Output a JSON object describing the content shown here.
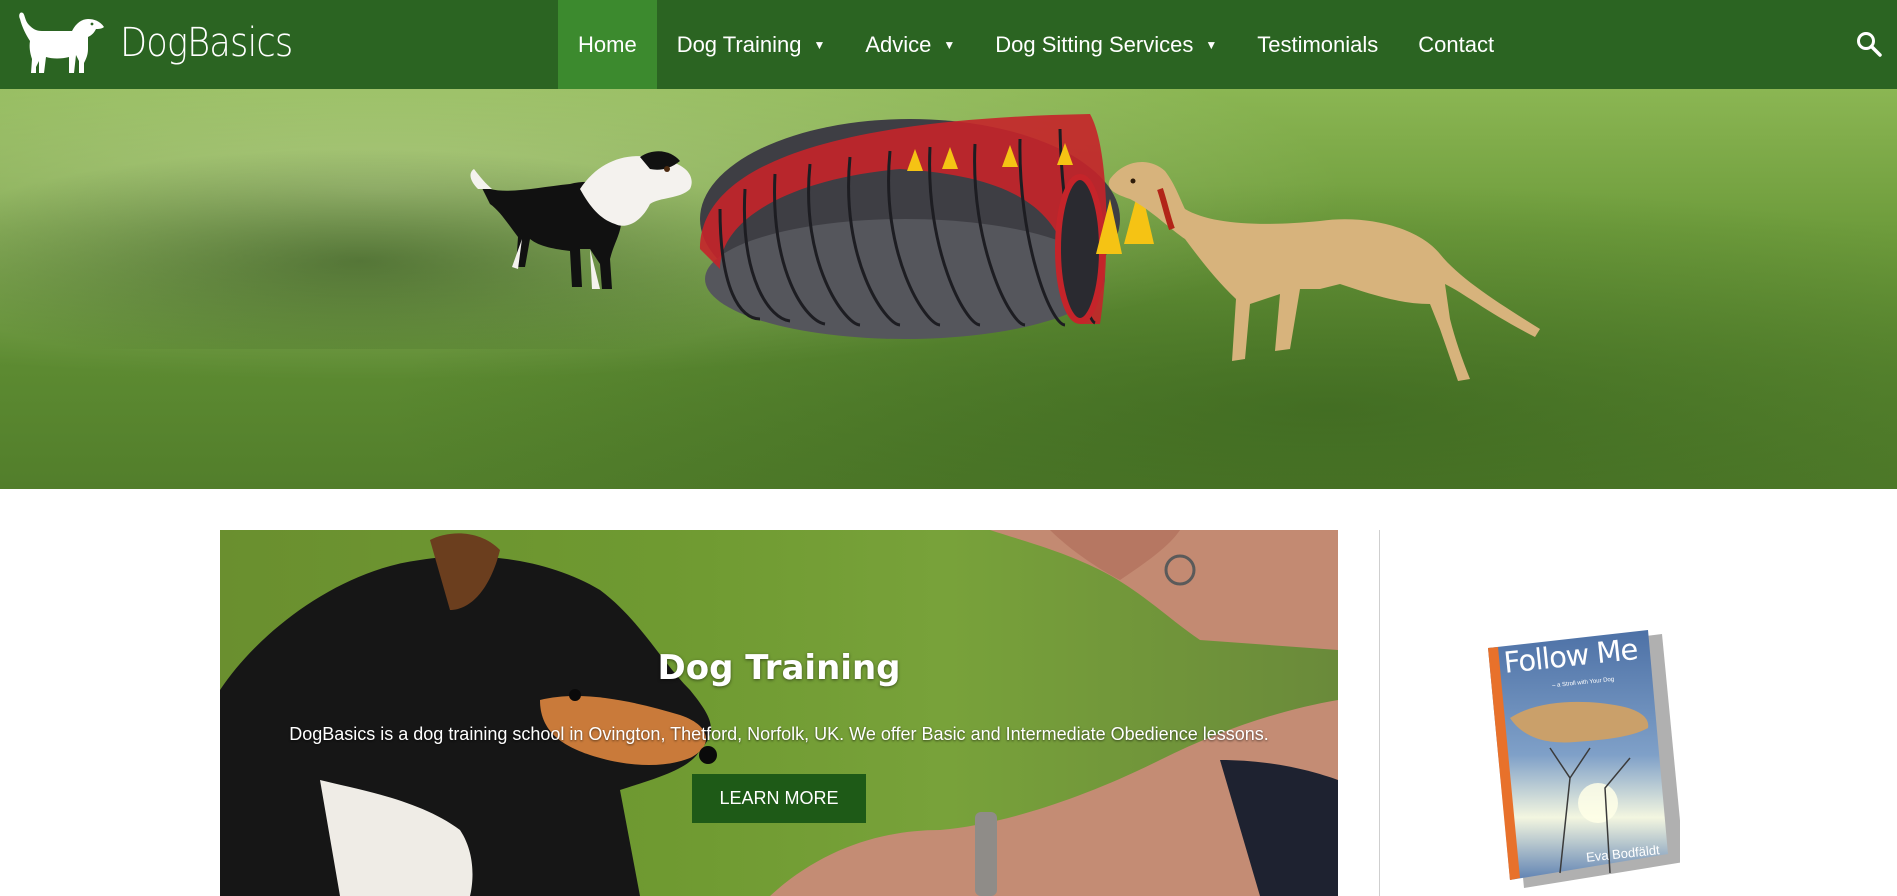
{
  "brand": {
    "name": "DogBasics"
  },
  "nav": {
    "items": [
      {
        "label": "Home",
        "active": true,
        "has_dropdown": false
      },
      {
        "label": "Dog Training",
        "active": false,
        "has_dropdown": true
      },
      {
        "label": "Advice",
        "active": false,
        "has_dropdown": true
      },
      {
        "label": "Dog Sitting Services",
        "active": false,
        "has_dropdown": true
      },
      {
        "label": "Testimonials",
        "active": false,
        "has_dropdown": false
      },
      {
        "label": "Contact",
        "active": false,
        "has_dropdown": false
      }
    ],
    "caret": "▼",
    "search_icon": "search-icon"
  },
  "feature": {
    "title": "Dog Training",
    "description": "DogBasics is a dog training school in Ovington, Thetford, Norfolk, UK. We offer Basic and Intermediate Obedience lessons.",
    "button_label": "LEARN MORE"
  },
  "book": {
    "title": "Follow Me",
    "subtitle": "– a Stroll with Your Dog",
    "author": "Eva Bodfäldt"
  },
  "colors": {
    "header_bg": "#2b6422",
    "nav_active_bg": "#3c8a2e",
    "button_bg": "#1e5a17",
    "text_light": "#ffffff"
  }
}
